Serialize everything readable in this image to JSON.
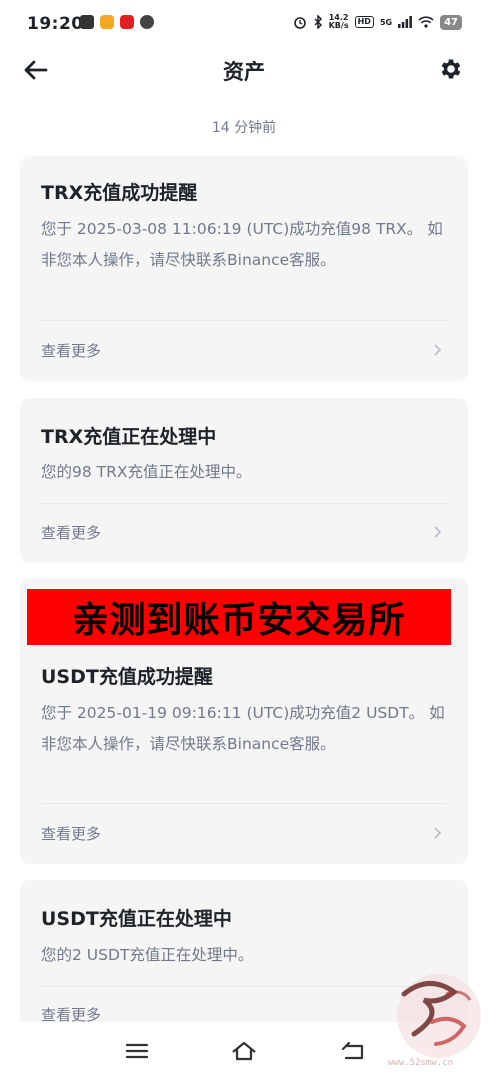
{
  "status_bar": {
    "time": "19:20",
    "speed_value": "14.2",
    "speed_unit": "KB/s",
    "hd": "HD",
    "network": "5G",
    "battery": "47"
  },
  "header": {
    "title": "资产"
  },
  "feed": {
    "time_ago": "14 分钟前"
  },
  "cards": [
    {
      "title": "TRX充值成功提醒",
      "body": "您于 2025-03-08 11:06:19 (UTC)成功充值98 TRX。 如非您本人操作，请尽快联系Binance客服。",
      "more": "查看更多"
    },
    {
      "title": "TRX充值正在处理中",
      "body": "您的98 TRX充值正在处理中。",
      "more": "查看更多"
    },
    {
      "title": "USDT充值成功提醒",
      "body": "您于 2025-01-19 09:16:11 (UTC)成功充值2 USDT。 如非您本人操作，请尽快联系Binance客服。",
      "more": "查看更多"
    },
    {
      "title": "USDT充值正在处理中",
      "body": "您的2 USDT充值正在处理中。",
      "more": "查看更多"
    }
  ],
  "overlay_banner": "亲测到账币安交易所",
  "watermark": {
    "url": "www.52smw.cn"
  },
  "icons": {
    "back": "arrow-left-icon",
    "settings": "gear-icon",
    "chevron": "chevron-right-icon",
    "nav_menu": "menu-icon",
    "nav_home": "home-icon",
    "nav_back": "back-icon"
  },
  "colors": {
    "text_primary": "#1e2329",
    "text_secondary": "#707a8a",
    "card_bg": "#f5f5f5",
    "banner_bg": "#ff0000"
  }
}
